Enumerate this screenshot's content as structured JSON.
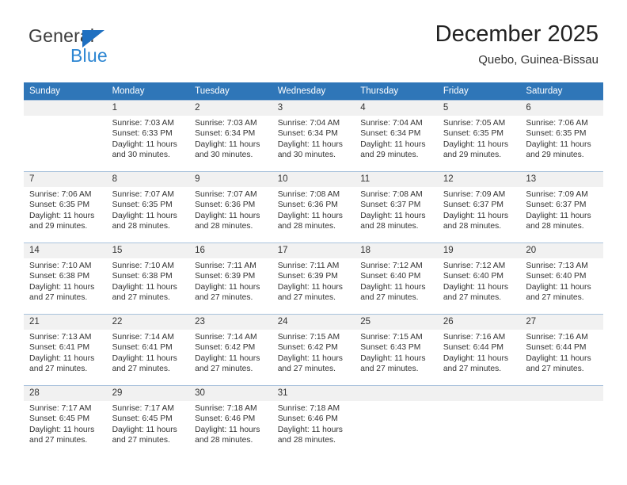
{
  "brand": {
    "name_part1": "General",
    "name_part2": "Blue",
    "triangle_color": "#1f70c1",
    "blue_color": "#2d86d2"
  },
  "header": {
    "title": "December 2025",
    "subtitle": "Quebo, Guinea-Bissau",
    "header_bg_color": "#2f76b8",
    "daynum_band_color": "#f1f1f1"
  },
  "weekdays": [
    "Sunday",
    "Monday",
    "Tuesday",
    "Wednesday",
    "Thursday",
    "Friday",
    "Saturday"
  ],
  "weeks": [
    [
      {
        "day": "",
        "sunrise": "",
        "sunset": "",
        "daylight1": "",
        "daylight2": ""
      },
      {
        "day": "1",
        "sunrise": "Sunrise: 7:03 AM",
        "sunset": "Sunset: 6:33 PM",
        "daylight1": "Daylight: 11 hours",
        "daylight2": "and 30 minutes."
      },
      {
        "day": "2",
        "sunrise": "Sunrise: 7:03 AM",
        "sunset": "Sunset: 6:34 PM",
        "daylight1": "Daylight: 11 hours",
        "daylight2": "and 30 minutes."
      },
      {
        "day": "3",
        "sunrise": "Sunrise: 7:04 AM",
        "sunset": "Sunset: 6:34 PM",
        "daylight1": "Daylight: 11 hours",
        "daylight2": "and 30 minutes."
      },
      {
        "day": "4",
        "sunrise": "Sunrise: 7:04 AM",
        "sunset": "Sunset: 6:34 PM",
        "daylight1": "Daylight: 11 hours",
        "daylight2": "and 29 minutes."
      },
      {
        "day": "5",
        "sunrise": "Sunrise: 7:05 AM",
        "sunset": "Sunset: 6:35 PM",
        "daylight1": "Daylight: 11 hours",
        "daylight2": "and 29 minutes."
      },
      {
        "day": "6",
        "sunrise": "Sunrise: 7:06 AM",
        "sunset": "Sunset: 6:35 PM",
        "daylight1": "Daylight: 11 hours",
        "daylight2": "and 29 minutes."
      }
    ],
    [
      {
        "day": "7",
        "sunrise": "Sunrise: 7:06 AM",
        "sunset": "Sunset: 6:35 PM",
        "daylight1": "Daylight: 11 hours",
        "daylight2": "and 29 minutes."
      },
      {
        "day": "8",
        "sunrise": "Sunrise: 7:07 AM",
        "sunset": "Sunset: 6:35 PM",
        "daylight1": "Daylight: 11 hours",
        "daylight2": "and 28 minutes."
      },
      {
        "day": "9",
        "sunrise": "Sunrise: 7:07 AM",
        "sunset": "Sunset: 6:36 PM",
        "daylight1": "Daylight: 11 hours",
        "daylight2": "and 28 minutes."
      },
      {
        "day": "10",
        "sunrise": "Sunrise: 7:08 AM",
        "sunset": "Sunset: 6:36 PM",
        "daylight1": "Daylight: 11 hours",
        "daylight2": "and 28 minutes."
      },
      {
        "day": "11",
        "sunrise": "Sunrise: 7:08 AM",
        "sunset": "Sunset: 6:37 PM",
        "daylight1": "Daylight: 11 hours",
        "daylight2": "and 28 minutes."
      },
      {
        "day": "12",
        "sunrise": "Sunrise: 7:09 AM",
        "sunset": "Sunset: 6:37 PM",
        "daylight1": "Daylight: 11 hours",
        "daylight2": "and 28 minutes."
      },
      {
        "day": "13",
        "sunrise": "Sunrise: 7:09 AM",
        "sunset": "Sunset: 6:37 PM",
        "daylight1": "Daylight: 11 hours",
        "daylight2": "and 28 minutes."
      }
    ],
    [
      {
        "day": "14",
        "sunrise": "Sunrise: 7:10 AM",
        "sunset": "Sunset: 6:38 PM",
        "daylight1": "Daylight: 11 hours",
        "daylight2": "and 27 minutes."
      },
      {
        "day": "15",
        "sunrise": "Sunrise: 7:10 AM",
        "sunset": "Sunset: 6:38 PM",
        "daylight1": "Daylight: 11 hours",
        "daylight2": "and 27 minutes."
      },
      {
        "day": "16",
        "sunrise": "Sunrise: 7:11 AM",
        "sunset": "Sunset: 6:39 PM",
        "daylight1": "Daylight: 11 hours",
        "daylight2": "and 27 minutes."
      },
      {
        "day": "17",
        "sunrise": "Sunrise: 7:11 AM",
        "sunset": "Sunset: 6:39 PM",
        "daylight1": "Daylight: 11 hours",
        "daylight2": "and 27 minutes."
      },
      {
        "day": "18",
        "sunrise": "Sunrise: 7:12 AM",
        "sunset": "Sunset: 6:40 PM",
        "daylight1": "Daylight: 11 hours",
        "daylight2": "and 27 minutes."
      },
      {
        "day": "19",
        "sunrise": "Sunrise: 7:12 AM",
        "sunset": "Sunset: 6:40 PM",
        "daylight1": "Daylight: 11 hours",
        "daylight2": "and 27 minutes."
      },
      {
        "day": "20",
        "sunrise": "Sunrise: 7:13 AM",
        "sunset": "Sunset: 6:40 PM",
        "daylight1": "Daylight: 11 hours",
        "daylight2": "and 27 minutes."
      }
    ],
    [
      {
        "day": "21",
        "sunrise": "Sunrise: 7:13 AM",
        "sunset": "Sunset: 6:41 PM",
        "daylight1": "Daylight: 11 hours",
        "daylight2": "and 27 minutes."
      },
      {
        "day": "22",
        "sunrise": "Sunrise: 7:14 AM",
        "sunset": "Sunset: 6:41 PM",
        "daylight1": "Daylight: 11 hours",
        "daylight2": "and 27 minutes."
      },
      {
        "day": "23",
        "sunrise": "Sunrise: 7:14 AM",
        "sunset": "Sunset: 6:42 PM",
        "daylight1": "Daylight: 11 hours",
        "daylight2": "and 27 minutes."
      },
      {
        "day": "24",
        "sunrise": "Sunrise: 7:15 AM",
        "sunset": "Sunset: 6:42 PM",
        "daylight1": "Daylight: 11 hours",
        "daylight2": "and 27 minutes."
      },
      {
        "day": "25",
        "sunrise": "Sunrise: 7:15 AM",
        "sunset": "Sunset: 6:43 PM",
        "daylight1": "Daylight: 11 hours",
        "daylight2": "and 27 minutes."
      },
      {
        "day": "26",
        "sunrise": "Sunrise: 7:16 AM",
        "sunset": "Sunset: 6:44 PM",
        "daylight1": "Daylight: 11 hours",
        "daylight2": "and 27 minutes."
      },
      {
        "day": "27",
        "sunrise": "Sunrise: 7:16 AM",
        "sunset": "Sunset: 6:44 PM",
        "daylight1": "Daylight: 11 hours",
        "daylight2": "and 27 minutes."
      }
    ],
    [
      {
        "day": "28",
        "sunrise": "Sunrise: 7:17 AM",
        "sunset": "Sunset: 6:45 PM",
        "daylight1": "Daylight: 11 hours",
        "daylight2": "and 27 minutes."
      },
      {
        "day": "29",
        "sunrise": "Sunrise: 7:17 AM",
        "sunset": "Sunset: 6:45 PM",
        "daylight1": "Daylight: 11 hours",
        "daylight2": "and 27 minutes."
      },
      {
        "day": "30",
        "sunrise": "Sunrise: 7:18 AM",
        "sunset": "Sunset: 6:46 PM",
        "daylight1": "Daylight: 11 hours",
        "daylight2": "and 28 minutes."
      },
      {
        "day": "31",
        "sunrise": "Sunrise: 7:18 AM",
        "sunset": "Sunset: 6:46 PM",
        "daylight1": "Daylight: 11 hours",
        "daylight2": "and 28 minutes."
      },
      {
        "day": "",
        "sunrise": "",
        "sunset": "",
        "daylight1": "",
        "daylight2": ""
      },
      {
        "day": "",
        "sunrise": "",
        "sunset": "",
        "daylight1": "",
        "daylight2": ""
      },
      {
        "day": "",
        "sunrise": "",
        "sunset": "",
        "daylight1": "",
        "daylight2": ""
      }
    ]
  ]
}
